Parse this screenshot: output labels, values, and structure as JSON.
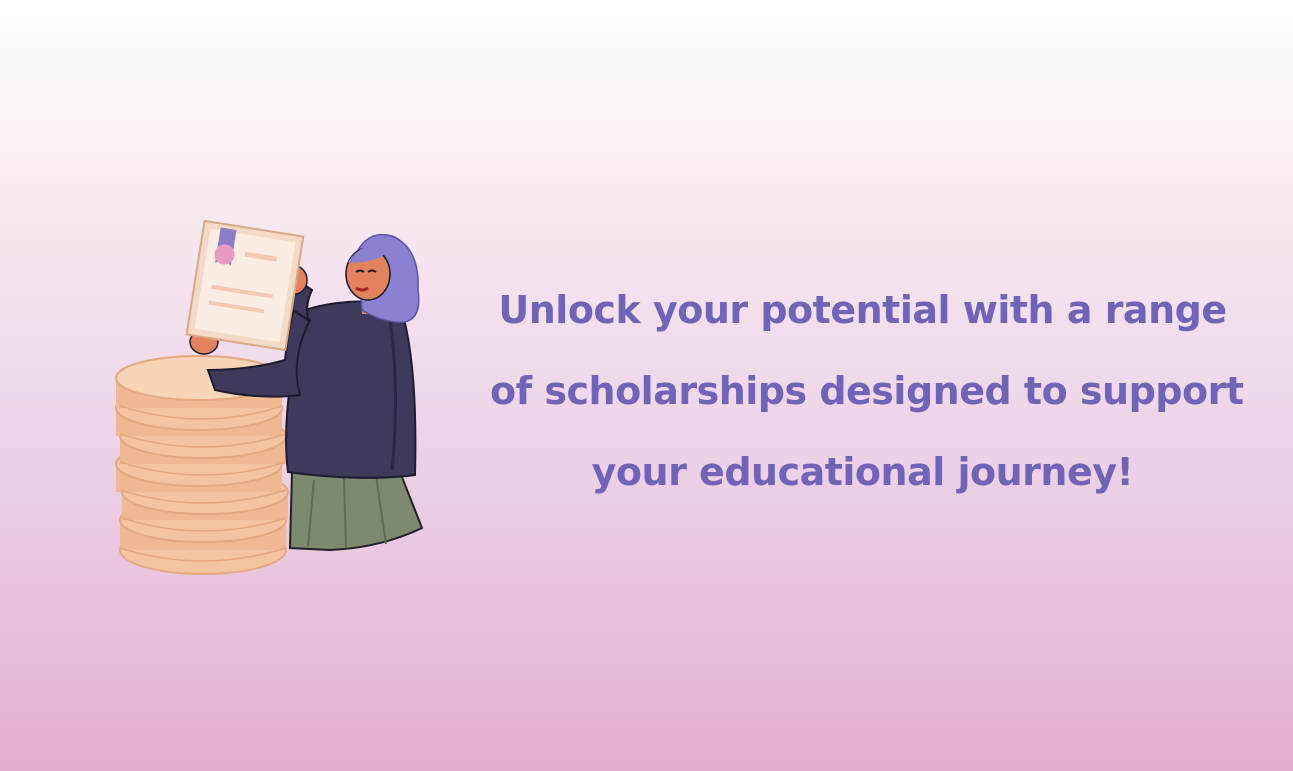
{
  "banner": {
    "headline_lines": [
      "Unlock your potential with a range",
      "of scholarships designed to support",
      "your educational journey!"
    ],
    "text_color": "#6f64b8",
    "background_top": "#ffffff",
    "background_bottom": "#e2aed3"
  },
  "illustration": {
    "name": "woman-holding-certificate-with-coin-stack"
  }
}
